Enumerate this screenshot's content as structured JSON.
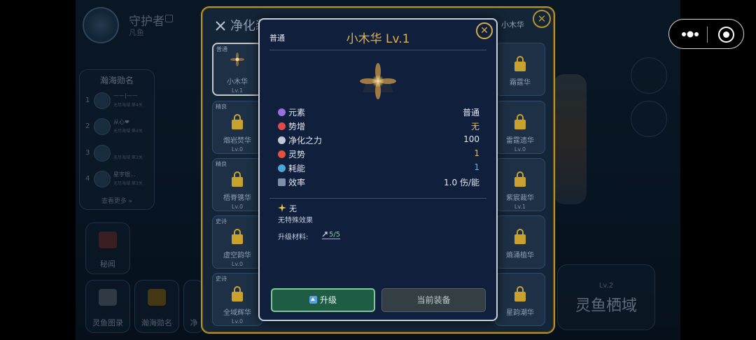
{
  "player": {
    "name": "守护者",
    "title": "凡鱼"
  },
  "ranking_panel": {
    "title": "瀚海勋名",
    "rows": [
      {
        "rank": "1",
        "name": "——|——",
        "sub": "无尽海域 第4关"
      },
      {
        "rank": "2",
        "name": "从心❤",
        "sub": "无尽海域 第4关"
      },
      {
        "rank": "3",
        "name": "",
        "sub": "无尽海域 第3关"
      },
      {
        "rank": "4",
        "name": "星宇银...",
        "sub": "无尽海域 第3关"
      }
    ],
    "more": "查看更多 »"
  },
  "side_buttons": {
    "secret": "秘闻",
    "codex": "灵鱼图录",
    "honor": "瀚海勋名",
    "partial": "净"
  },
  "domain": {
    "level": "Lv.2",
    "name": "灵鱼栖域"
  },
  "equip_panel": {
    "title": "净化装置",
    "right_label": "小木华",
    "tiles": [
      {
        "rarity": "普通",
        "name": "小木华",
        "lv": "Lv.1",
        "locked": false
      },
      {
        "rarity": "精良",
        "name": "烟岩焚华",
        "lv": "Lv.0",
        "locked": true
      },
      {
        "rarity": "精良",
        "name": "梧脊镌华",
        "lv": "Lv.0",
        "locked": true
      },
      {
        "rarity": "史诗",
        "name": "虚空韵华",
        "lv": "Lv.0",
        "locked": true
      },
      {
        "rarity": "史诗",
        "name": "全域辉华",
        "lv": "Lv.0",
        "locked": true
      },
      {
        "rarity": "",
        "name": "霜霆华",
        "lv": "",
        "locked": true
      },
      {
        "rarity": "",
        "name": "雷霆遗华",
        "lv": "Lv.0",
        "locked": true
      },
      {
        "rarity": "",
        "name": "紫宸裁华",
        "lv": "Lv.1",
        "locked": true
      },
      {
        "rarity": "",
        "name": "熵涌植华",
        "lv": "",
        "locked": true
      },
      {
        "rarity": "",
        "name": "星韵潮华",
        "lv": "",
        "locked": true
      }
    ]
  },
  "modal": {
    "rarity": "普通",
    "title": "小木华 Lv.1",
    "stats": [
      {
        "label": "元素",
        "value": "普通",
        "icon": "element-icon",
        "value_color": "#e4e7ee",
        "icon_color": "#9a6ee0"
      },
      {
        "label": "势增",
        "value": "无",
        "icon": "target-icon",
        "value_color": "#e9c14a",
        "icon_color": "#e04a4a"
      },
      {
        "label": "净化之力",
        "value": "100",
        "icon": "crossed-swords-icon",
        "value_color": "#e4e7ee",
        "icon_color": "#c0c8d6"
      },
      {
        "label": "灵势",
        "value": "1",
        "icon": "burst-icon",
        "value_color": "#e9c14a",
        "icon_color": "#e8503a"
      },
      {
        "label": "耗能",
        "value": "1",
        "icon": "energy-icon",
        "value_color": "#5fb5ea",
        "icon_color": "#4aa8d8"
      },
      {
        "label": "效率",
        "value": "1.0 伤/能",
        "icon": "chart-icon",
        "value_color": "#e4e7ee",
        "icon_color": "#7e8ea8"
      }
    ],
    "special_title": "无",
    "special_desc": "无特殊效果",
    "material_label": "升级材料:",
    "material_value": "5/5",
    "upgrade_label": "升级",
    "equipped_label": "当前装备"
  },
  "colors": {
    "gold": "#d9ad45",
    "accent_green": "#1f5c44",
    "modal_bg": "#0f1f3c"
  }
}
